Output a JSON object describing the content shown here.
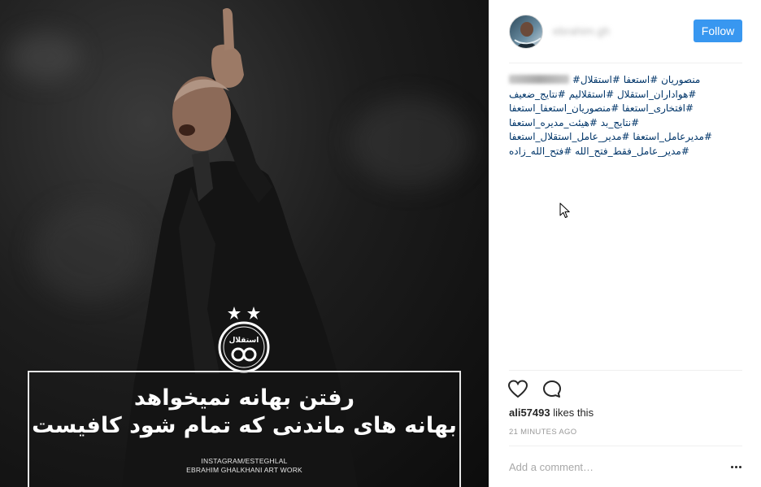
{
  "post": {
    "caption_line_1": "رفتن بهانه نمیخواهد",
    "caption_line_2": "بهانه های ماندنی که تمام شود کافیست",
    "credit_line_1": "INSTAGRAM/ESTEGHLAL",
    "credit_line_2": "EBRAHIM GHALKHANI ART WORK",
    "club_logo_text": "استقلال"
  },
  "header": {
    "username": "ebrahim.gh",
    "follow_label": "Follow"
  },
  "comment": {
    "lines": [
      "منصوریان #استعفا #استقلال#",
      "#هواداران_استقلال #استقلالیم #نتایج_ضعیف",
      "#افتخاری_استعفا #منصوریان_استعفا_استعفا",
      "#نتایج_بد #هیئت_مدیره_استعفا",
      "#مدیرعامل_استعفا #مدیر_عامل_استقلال_استعفا",
      "#مدیر_عامل_فقط_فتح_الله #فتح_الله_زاده"
    ]
  },
  "likes": {
    "liker": "ali57493",
    "suffix": " likes this"
  },
  "timestamp": "21 MINUTES AGO",
  "add_comment": {
    "placeholder": "Add a comment…"
  },
  "colors": {
    "accent": "#3897f0",
    "hashtag": "#003569"
  }
}
